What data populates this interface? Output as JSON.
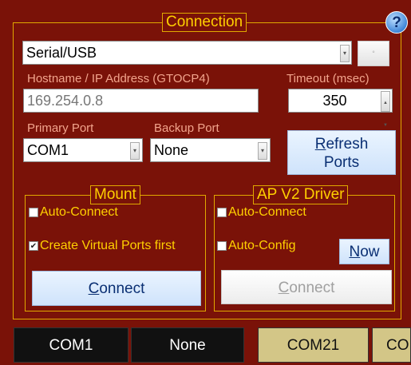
{
  "connection": {
    "title": "Connection",
    "help_label": "?",
    "type_value": "Serial/USB",
    "host_label": "Hostname / IP Address (GTOCP4)",
    "host_value": "169.254.0.8",
    "timeout_label": "Timeout (msec)",
    "timeout_value": "350",
    "primary_label": "Primary Port",
    "primary_value": "COM1",
    "backup_label": "Backup Port",
    "backup_value": "None",
    "refresh_line1_accel": "R",
    "refresh_line1_rest": "efresh",
    "refresh_line2": "Ports"
  },
  "mount": {
    "title": "Mount",
    "auto_connect_label": "Auto-Connect",
    "auto_connect_checked": false,
    "virtual_ports_label": "Create Virtual Ports first",
    "virtual_ports_checked": true,
    "connect_accel": "C",
    "connect_rest": "onnect"
  },
  "ap_driver": {
    "title": "AP V2 Driver",
    "auto_connect_label": "Auto-Connect",
    "auto_connect_checked": false,
    "auto_config_label": "Auto-Config",
    "auto_config_checked": false,
    "now_accel": "N",
    "now_rest": "ow",
    "connect_accel": "C",
    "connect_rest": "onnect",
    "connect_enabled": false
  },
  "port_tabs": [
    "COM1",
    "None",
    "COM21",
    "CO"
  ],
  "colors": {
    "background": "#7a1208",
    "frame_gold": "#e0a800",
    "title_yellow": "#ffd000",
    "label_salmon": "#f2a48c",
    "button_blue_text": "#0a2f73",
    "port_active_dark": "#111111",
    "port_gold": "#d3c687"
  },
  "icons": {
    "help": "question-circle-icon",
    "dropdown": "chevron-down-icon",
    "spinner": "up-down-arrows-icon"
  }
}
